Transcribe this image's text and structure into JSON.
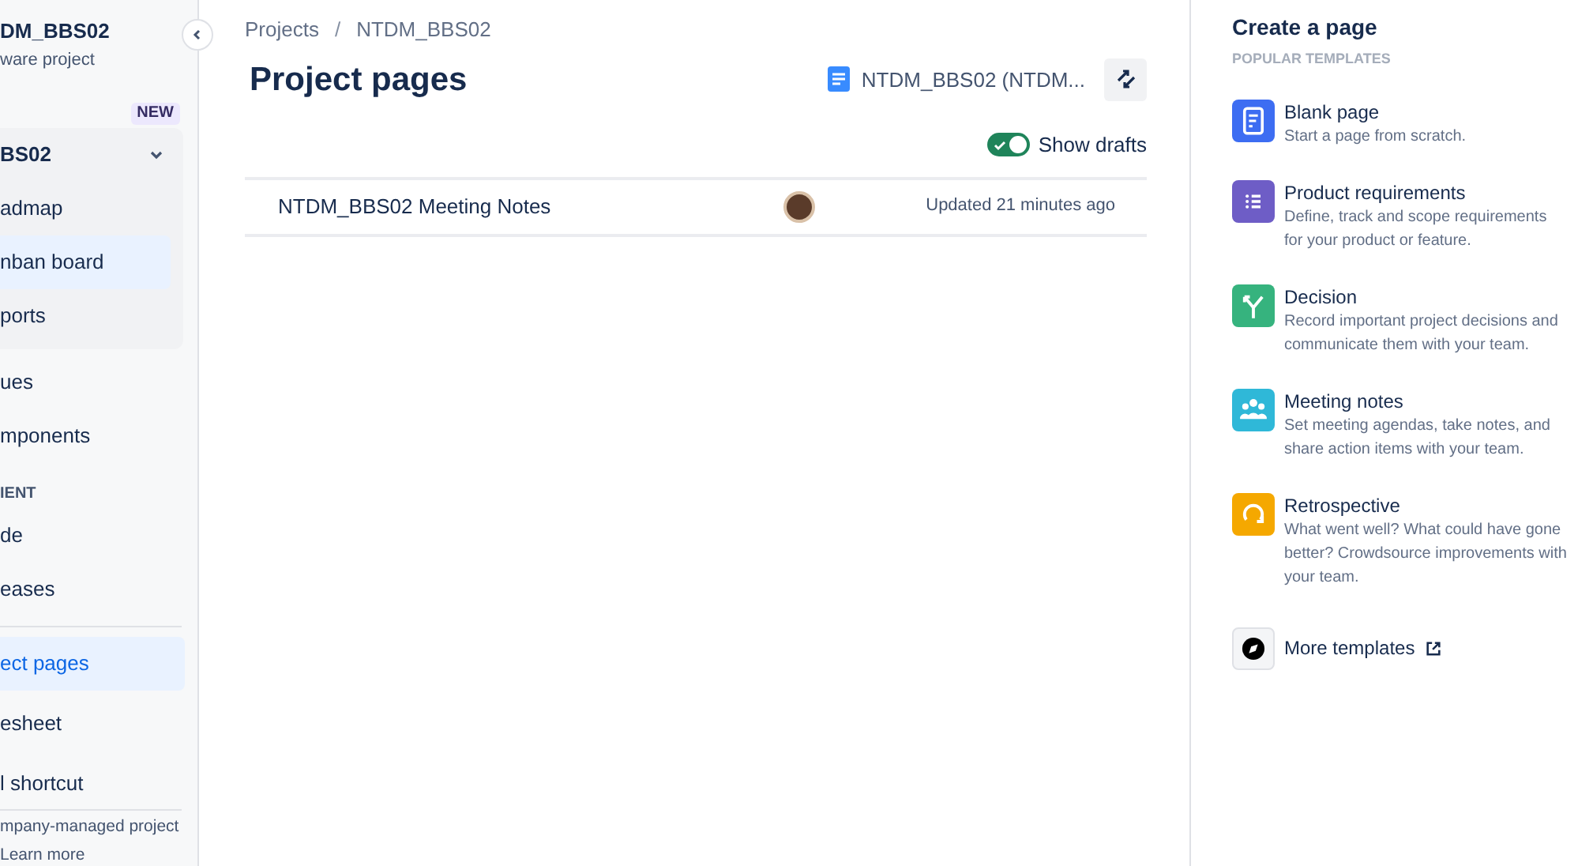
{
  "sidebar": {
    "project_name": "DM_BBS02",
    "project_type": "ware project",
    "new_badge": "NEW",
    "group": {
      "title": "BS02",
      "expanded": true,
      "items": [
        {
          "label": "admap",
          "selected": false
        },
        {
          "label": "nban board",
          "selected": true
        },
        {
          "label": "ports",
          "selected": false
        }
      ]
    },
    "items": [
      {
        "label": "ues",
        "selected": false
      },
      {
        "label": "mponents",
        "selected": false
      }
    ],
    "section_heading": "IENT",
    "section_items": [
      {
        "label": "de",
        "selected": false
      },
      {
        "label": "eases",
        "selected": false
      }
    ],
    "lower_items": [
      {
        "label": "ect pages",
        "selected": true
      },
      {
        "label": "esheet",
        "selected": false
      },
      {
        "label": "l shortcut",
        "selected": false
      }
    ],
    "footer": {
      "text": "mpany-managed project",
      "link": "Learn more"
    }
  },
  "breadcrumbs": [
    "Projects",
    "NTDM_BBS02"
  ],
  "breadcrumb_separator": "/",
  "title": "Project pages",
  "space_link": "NTDM_BBS02 (NTDM...",
  "show_drafts": {
    "label": "Show drafts",
    "on": true
  },
  "pages": [
    {
      "title": "NTDM_BBS02 Meeting Notes",
      "updated": "Updated 21 minutes ago"
    }
  ],
  "create_panel": {
    "title": "Create a page",
    "subtitle": "POPULAR TEMPLATES",
    "templates": [
      {
        "kind": "blank",
        "name": "Blank page",
        "description": "Start a page from scratch.",
        "color": "#3d6df2"
      },
      {
        "kind": "requirements",
        "name": "Product requirements",
        "description": "Define, track and scope requirements for your product or feature.",
        "color": "#6e5dc6"
      },
      {
        "kind": "decision",
        "name": "Decision",
        "description": "Record important project decisions and communicate them with your team.",
        "color": "#36b37e"
      },
      {
        "kind": "meeting",
        "name": "Meeting notes",
        "description": "Set meeting agendas, take notes, and share action items with your team.",
        "color": "#2fb8d8"
      },
      {
        "kind": "retro",
        "name": "Retrospective",
        "description": "What went well? What could have gone better? Crowdsource improvements with your team.",
        "color": "#f5a800"
      }
    ],
    "more": "More templates"
  }
}
